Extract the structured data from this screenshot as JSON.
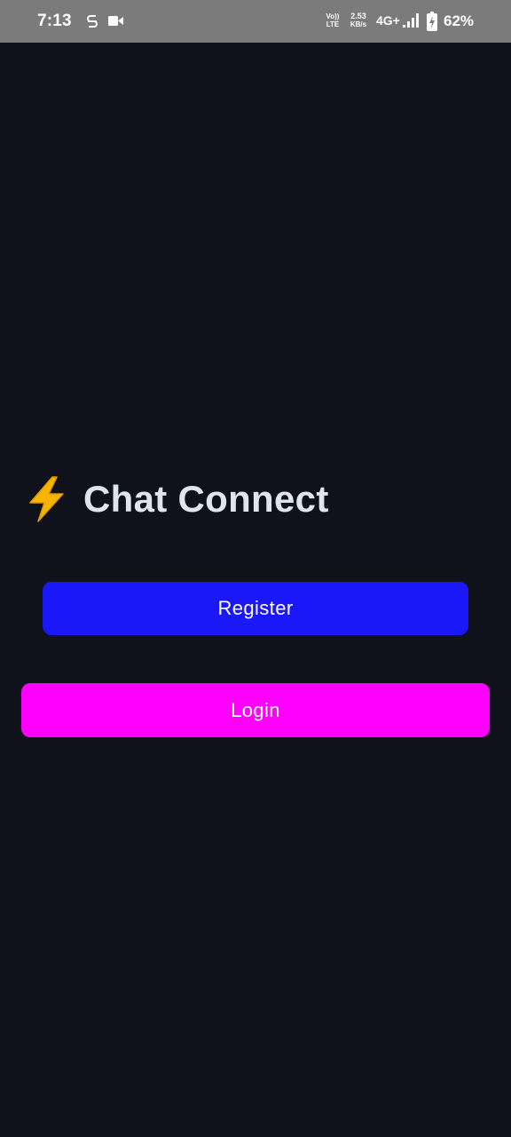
{
  "status_bar": {
    "time": "7:13",
    "volte_top": "Vo))",
    "volte_bottom": "LTE",
    "net_speed_value": "2.53",
    "net_speed_unit": "KB/s",
    "network_type": "4G+",
    "battery_percent": "62%",
    "icons": [
      "s-badge-icon",
      "video-camera-icon",
      "signal-strength-icon",
      "battery-charging-icon"
    ]
  },
  "app": {
    "title": "Chat Connect",
    "title_icon": "lightning-bolt-icon",
    "register_label": "Register",
    "login_label": "Login"
  },
  "colors": {
    "background": "#0f121a",
    "status_bar": "#7b7b7b",
    "title_text": "#dfe4ee",
    "register_button": "#1a17f8",
    "login_button": "#ff00ff",
    "bolt": "#f7b500"
  }
}
